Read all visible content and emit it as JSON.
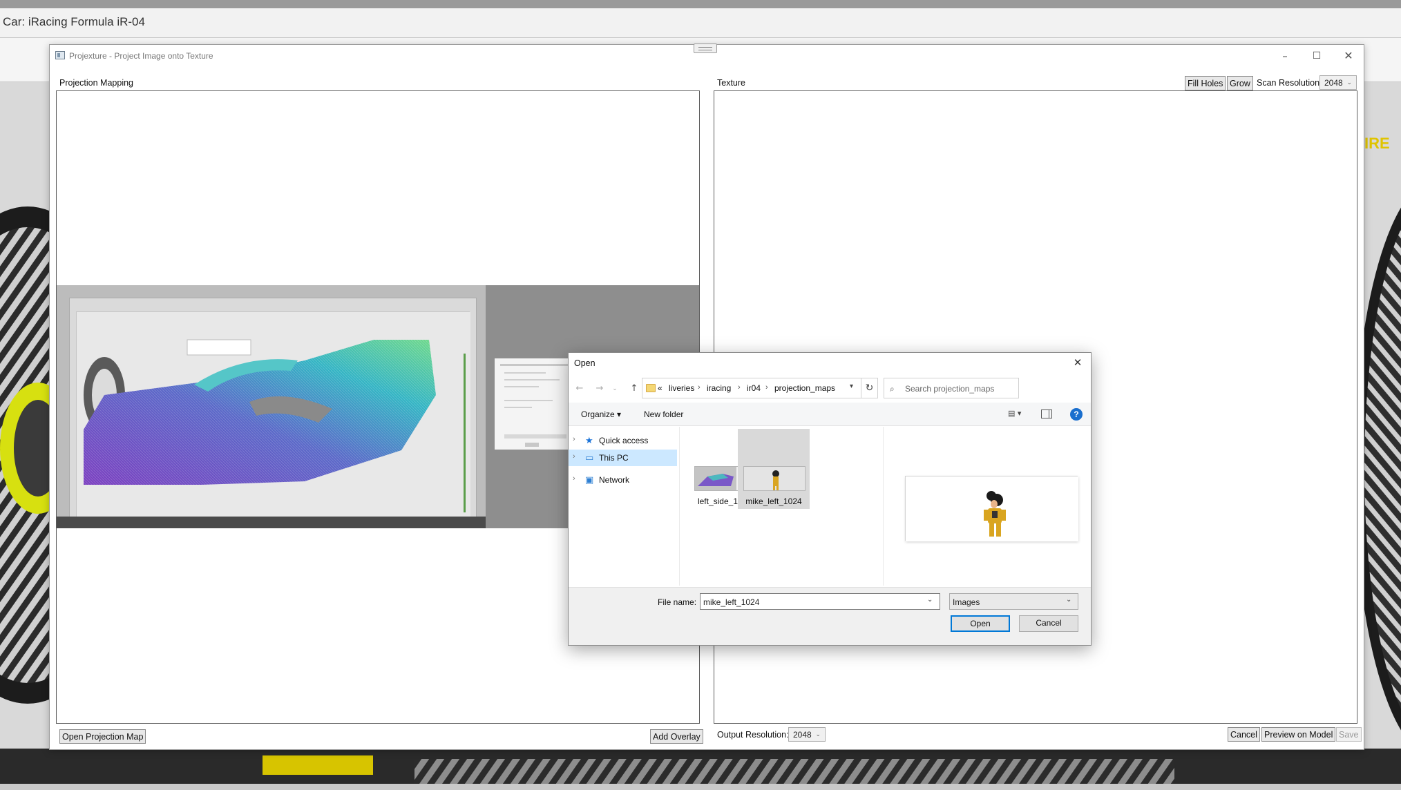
{
  "app": {
    "title": "Car: iRacing Formula iR-04"
  },
  "projexture": {
    "title": "Projexture - Project Image onto Texture",
    "window_controls": {
      "minimize": "–",
      "maximize": "☐",
      "close": "✕"
    },
    "projection_panel": {
      "label": "Projection Mapping",
      "open_button": "Open Projection Map",
      "add_overlay_button": "Add Overlay"
    },
    "texture_panel": {
      "label": "Texture",
      "fill_holes_button": "Fill Holes",
      "grow_button": "Grow",
      "scan_resolution_label": "Scan Resolution:",
      "scan_resolution_value": "2048",
      "output_resolution_label": "Output Resolution:",
      "output_resolution_value": "2048",
      "cancel_button": "Cancel",
      "preview_button": "Preview on Model",
      "save_button": "Save"
    }
  },
  "open_dialog": {
    "title": "Open",
    "close": "✕",
    "nav": {
      "back": "←",
      "forward": "→",
      "recent": "⌄",
      "up": "↑",
      "refresh": "↻"
    },
    "breadcrumb": {
      "overflow": "«",
      "items": [
        "liveries",
        "iracing",
        "ir04",
        "projection_maps"
      ],
      "separator": "›"
    },
    "search_placeholder": "Search projection_maps",
    "toolbar": {
      "organize": "Organize ▾",
      "new_folder": "New folder",
      "help": "?"
    },
    "sidebar": [
      {
        "label": "Quick access",
        "icon": "star-icon"
      },
      {
        "label": "This PC",
        "icon": "computer-icon",
        "selected": true
      },
      {
        "label": "Network",
        "icon": "network-icon"
      }
    ],
    "files": [
      {
        "name": "left_side_1024",
        "selected": false
      },
      {
        "name": "mike_left_1024",
        "selected": true
      }
    ],
    "file_name_label": "File name:",
    "file_name_value": "mike_left_1024",
    "file_type_value": "Images",
    "open_button": "Open",
    "cancel_button": "Cancel"
  }
}
